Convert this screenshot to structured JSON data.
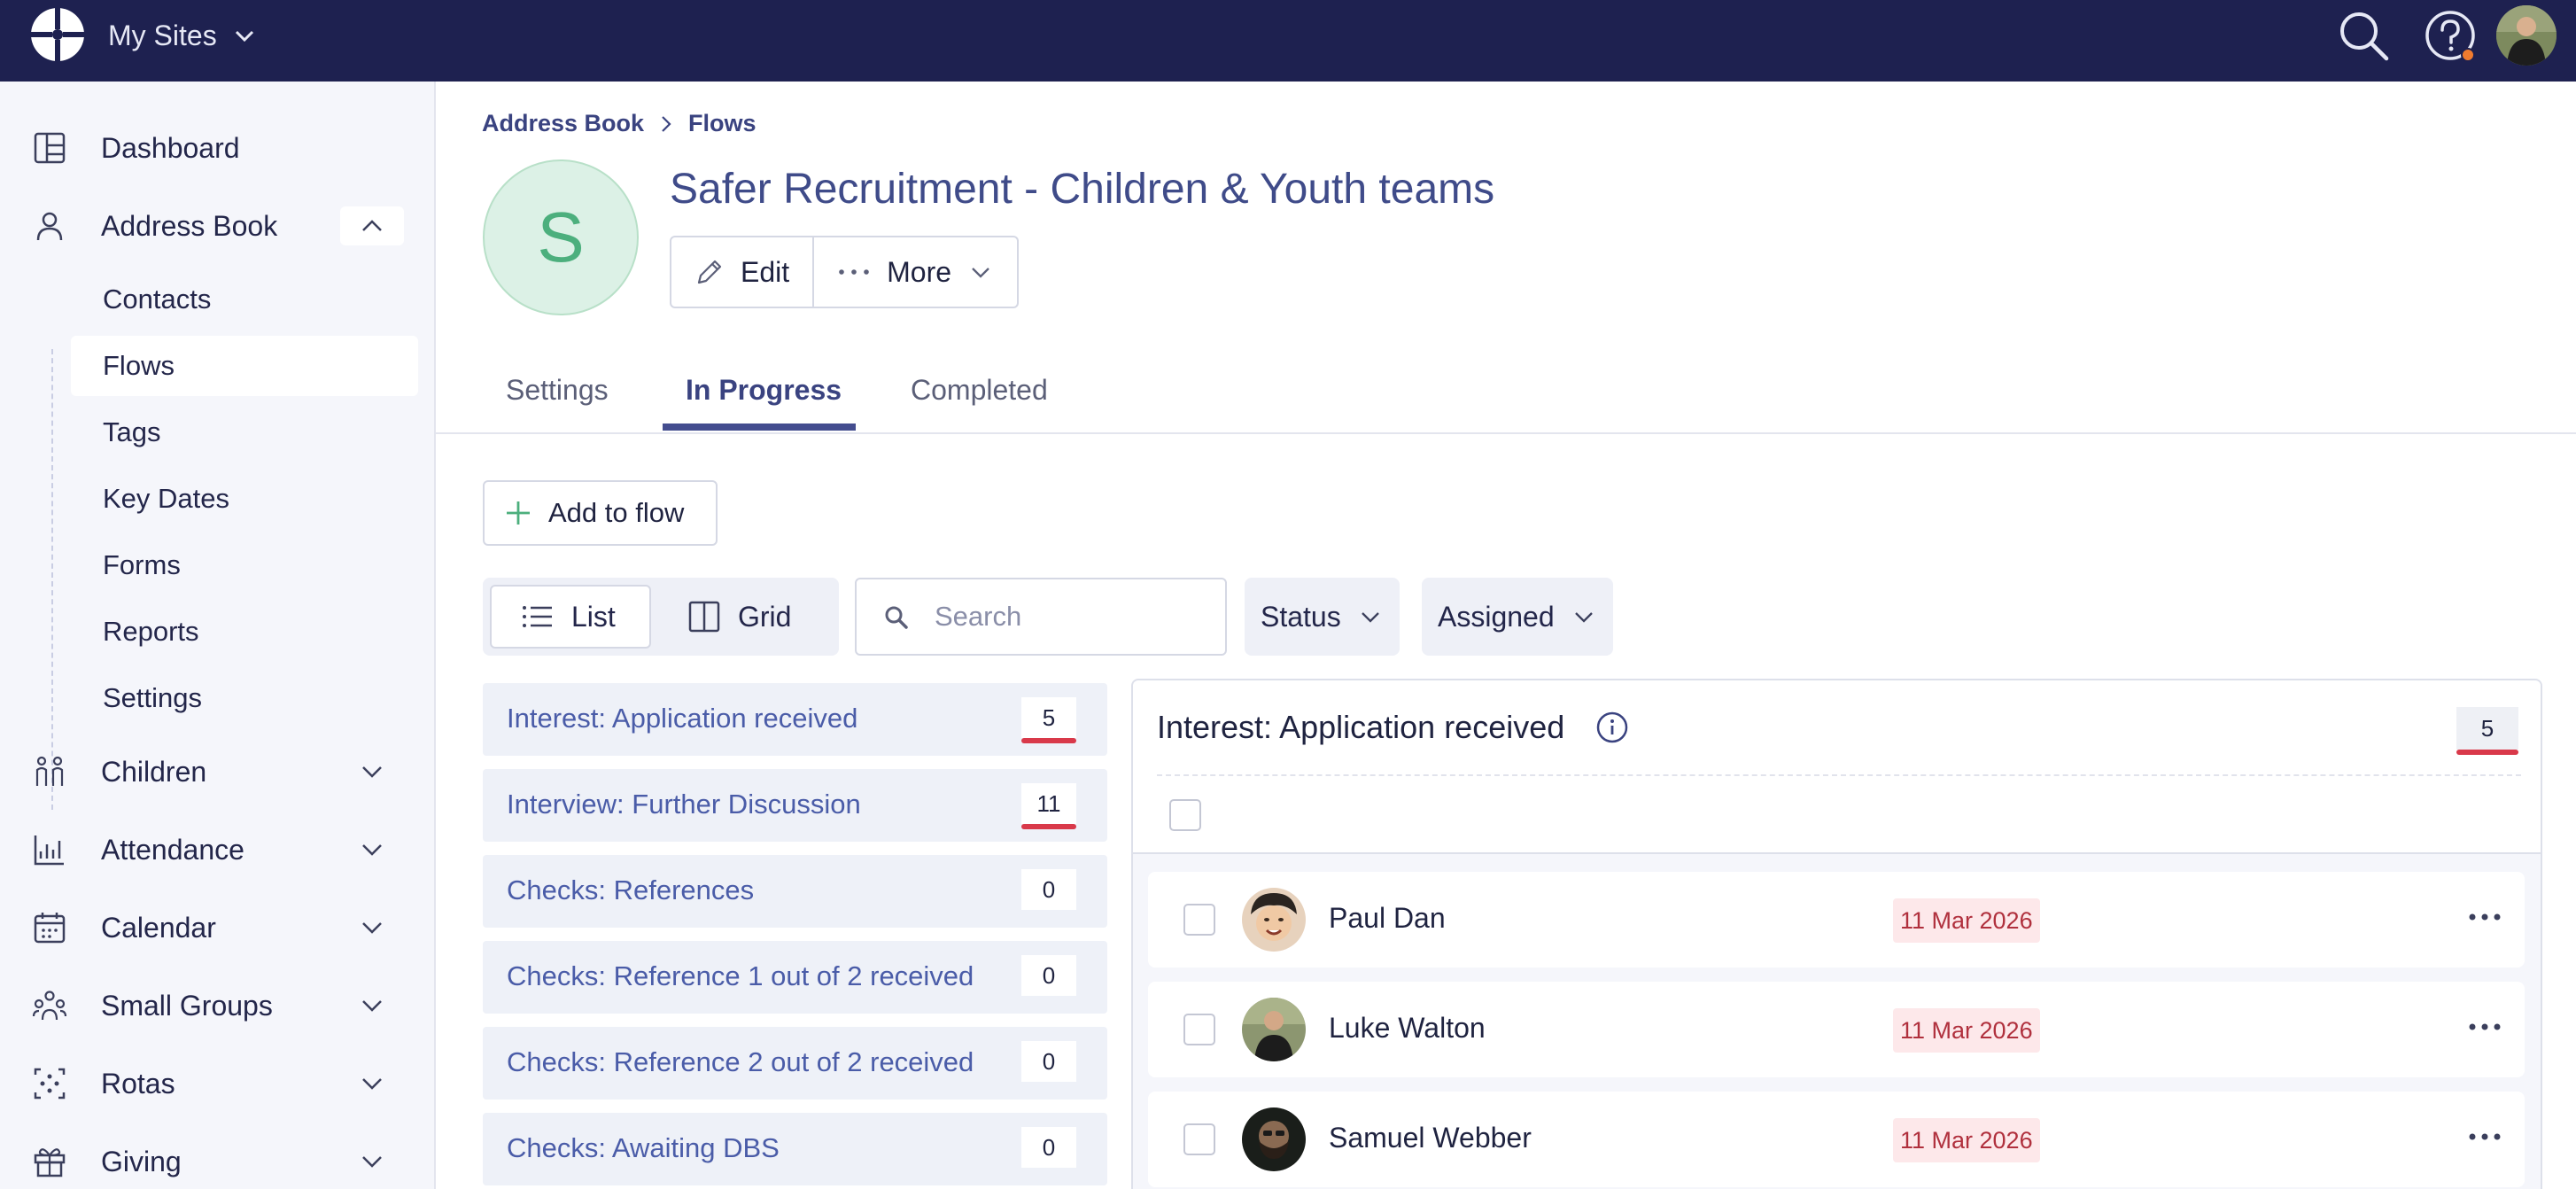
{
  "topbar": {
    "site_switcher_label": "My Sites",
    "icons": [
      "logo-icon",
      "search-icon",
      "help-icon",
      "avatar"
    ]
  },
  "sidebar": {
    "dashboard": "Dashboard",
    "address_book": "Address Book",
    "sub_items": [
      "Contacts",
      "Flows",
      "Tags",
      "Key Dates",
      "Forms",
      "Reports",
      "Settings"
    ],
    "active_sub_item": "Flows",
    "children": "Children",
    "attendance": "Attendance",
    "calendar": "Calendar",
    "small_groups": "Small Groups",
    "rotas": "Rotas",
    "giving": "Giving"
  },
  "breadcrumb": {
    "root": "Address Book",
    "current": "Flows"
  },
  "flow": {
    "avatar_letter": "S",
    "title": "Safer Recruitment - Children & Youth teams",
    "edit_label": "Edit",
    "more_label": "More"
  },
  "tabs": {
    "settings": "Settings",
    "in_progress": "In Progress",
    "completed": "Completed",
    "active": "In Progress"
  },
  "toolbar": {
    "add_label": "Add to flow",
    "list_label": "List",
    "grid_label": "Grid",
    "active_view": "List",
    "search_placeholder": "Search",
    "status_label": "Status",
    "assigned_label": "Assigned"
  },
  "stages": [
    {
      "label": "Interest: Application received",
      "count": "5"
    },
    {
      "label": "Interview: Further Discussion",
      "count": "11"
    },
    {
      "label": "Checks: References",
      "count": "0"
    },
    {
      "label": "Checks: Reference 1 out of 2 received",
      "count": "0"
    },
    {
      "label": "Checks: Reference 2 out of 2 received",
      "count": "0"
    },
    {
      "label": "Checks: Awaiting DBS",
      "count": "0"
    }
  ],
  "panel": {
    "title": "Interest: Application received",
    "count": "5",
    "people": [
      {
        "name": "Paul Dan",
        "date": "11 Mar 2026"
      },
      {
        "name": "Luke Walton",
        "date": "11 Mar 2026"
      },
      {
        "name": "Samuel Webber",
        "date": "11 Mar 2026"
      }
    ]
  },
  "colors": {
    "topbar": "#1e2150",
    "accent": "#444d8f",
    "link": "#4a5ca8",
    "count_bar": "#d9394a",
    "avatar_green": "#dcf1e6",
    "date_badge_bg": "#fde8ea",
    "date_badge_text": "#b0303d",
    "notification_dot": "#f07b2f"
  }
}
